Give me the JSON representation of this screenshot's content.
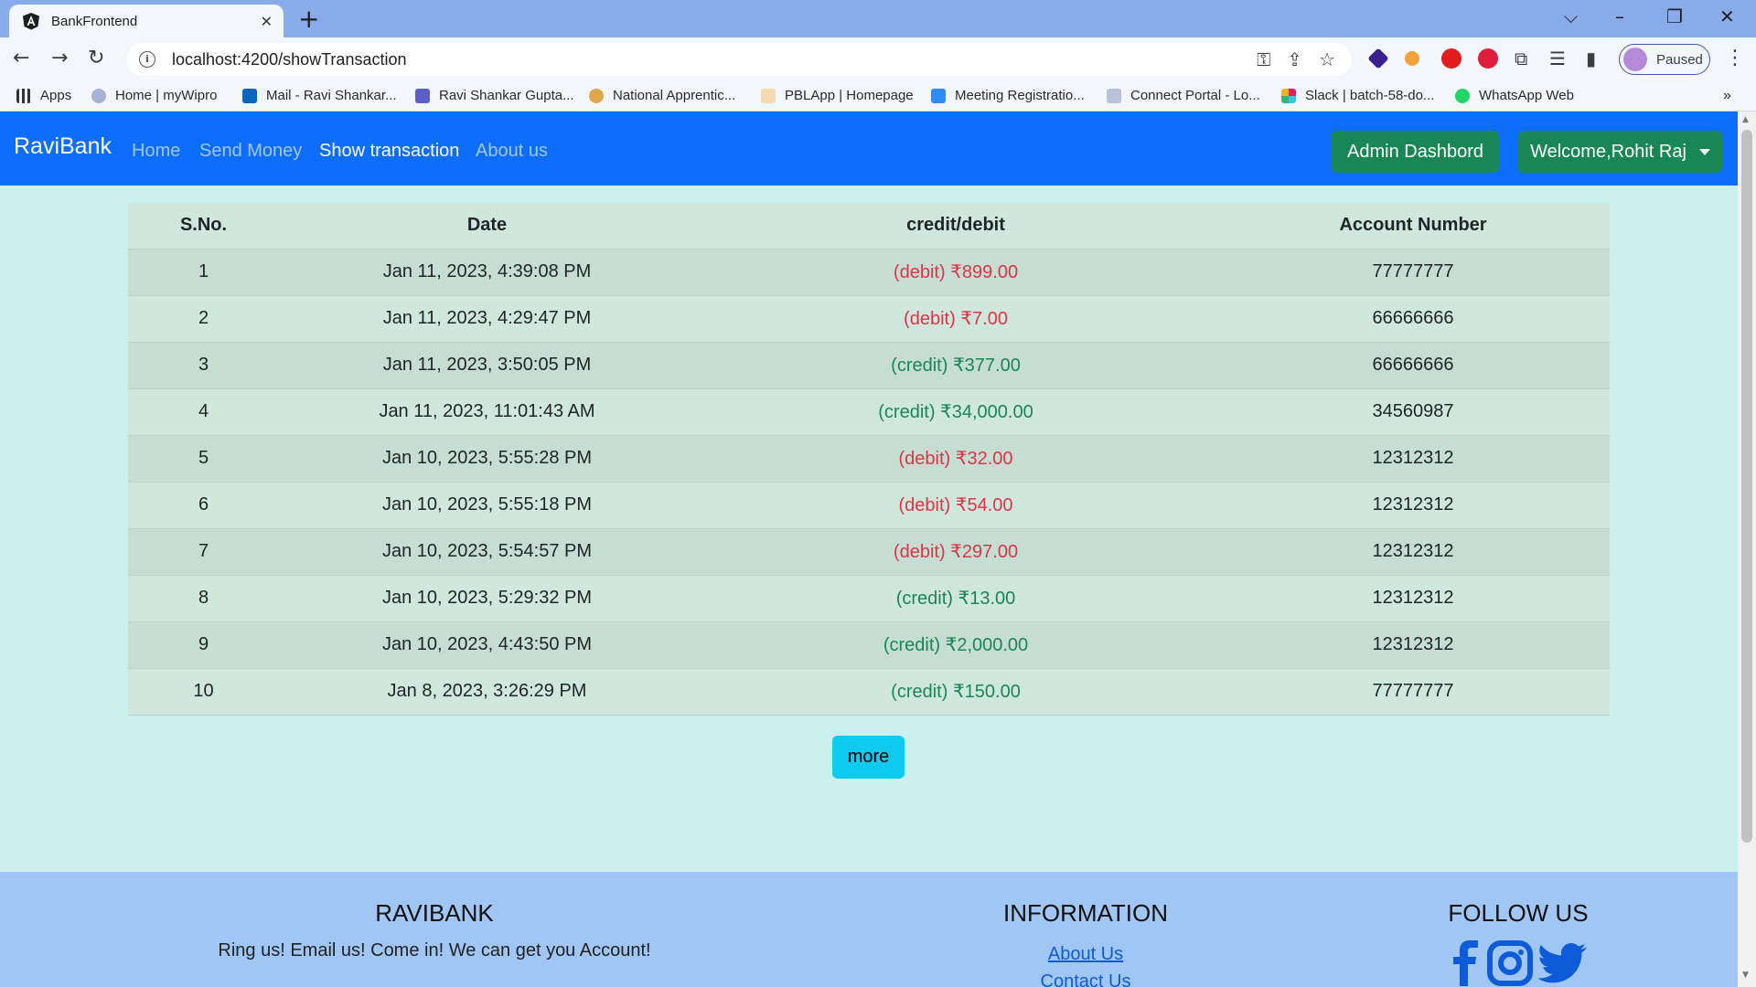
{
  "browser": {
    "tab_title": "BankFrontend",
    "url": "localhost:4200/showTransaction",
    "profile_status": "Paused",
    "bookmarks": [
      {
        "label": "Apps"
      },
      {
        "label": "Home | myWipro"
      },
      {
        "label": "Mail - Ravi Shankar..."
      },
      {
        "label": "Ravi Shankar Gupta..."
      },
      {
        "label": "National Apprentic..."
      },
      {
        "label": "PBLApp | Homepage"
      },
      {
        "label": "Meeting Registratio..."
      },
      {
        "label": "Connect Portal - Lo..."
      },
      {
        "label": "Slack | batch-58-do..."
      },
      {
        "label": "WhatsApp Web"
      }
    ]
  },
  "navbar": {
    "brand": "RaviBank",
    "links": [
      "Home",
      "Send Money",
      "Show transaction",
      "About us"
    ],
    "active_link": "Show transaction",
    "admin_button": "Admin Dashbord",
    "welcome_button": "Welcome,Rohit Raj"
  },
  "table": {
    "headers": [
      "S.No.",
      "Date",
      "credit/debit",
      "Account Number"
    ],
    "rows": [
      {
        "sno": "1",
        "date": "Jan 11, 2023, 4:39:08 PM",
        "type": "debit",
        "amount": "(debit) ₹899.00",
        "account": "77777777"
      },
      {
        "sno": "2",
        "date": "Jan 11, 2023, 4:29:47 PM",
        "type": "debit",
        "amount": "(debit) ₹7.00",
        "account": "66666666"
      },
      {
        "sno": "3",
        "date": "Jan 11, 2023, 3:50:05 PM",
        "type": "credit",
        "amount": "(credit) ₹377.00",
        "account": "66666666"
      },
      {
        "sno": "4",
        "date": "Jan 11, 2023, 11:01:43 AM",
        "type": "credit",
        "amount": "(credit) ₹34,000.00",
        "account": "34560987"
      },
      {
        "sno": "5",
        "date": "Jan 10, 2023, 5:55:28 PM",
        "type": "debit",
        "amount": "(debit) ₹32.00",
        "account": "12312312"
      },
      {
        "sno": "6",
        "date": "Jan 10, 2023, 5:55:18 PM",
        "type": "debit",
        "amount": "(debit) ₹54.00",
        "account": "12312312"
      },
      {
        "sno": "7",
        "date": "Jan 10, 2023, 5:54:57 PM",
        "type": "debit",
        "amount": "(debit) ₹297.00",
        "account": "12312312"
      },
      {
        "sno": "8",
        "date": "Jan 10, 2023, 5:29:32 PM",
        "type": "credit",
        "amount": "(credit) ₹13.00",
        "account": "12312312"
      },
      {
        "sno": "9",
        "date": "Jan 10, 2023, 4:43:50 PM",
        "type": "credit",
        "amount": "(credit) ₹2,000.00",
        "account": "12312312"
      },
      {
        "sno": "10",
        "date": "Jan 8, 2023, 3:26:29 PM",
        "type": "credit",
        "amount": "(credit) ₹150.00",
        "account": "77777777"
      }
    ]
  },
  "more_button": "more",
  "footer": {
    "brand_title": "RAVIBANK",
    "brand_text": "Ring us! Email us! Come in! We can get you Account!",
    "info_title": "INFORMATION",
    "info_links": [
      "About Us",
      "Contact Us"
    ],
    "follow_title": "FOLLOW US",
    "social_icons": [
      "facebook-icon",
      "instagram-icon",
      "twitter-icon"
    ]
  },
  "colors": {
    "navbar": "#0d6efd",
    "page_bg": "#cbf0ee",
    "debit": "#dc3545",
    "credit": "#198754",
    "footer": "#a0c6f5",
    "more_button": "#0dcaf0",
    "green_button": "#198754"
  }
}
